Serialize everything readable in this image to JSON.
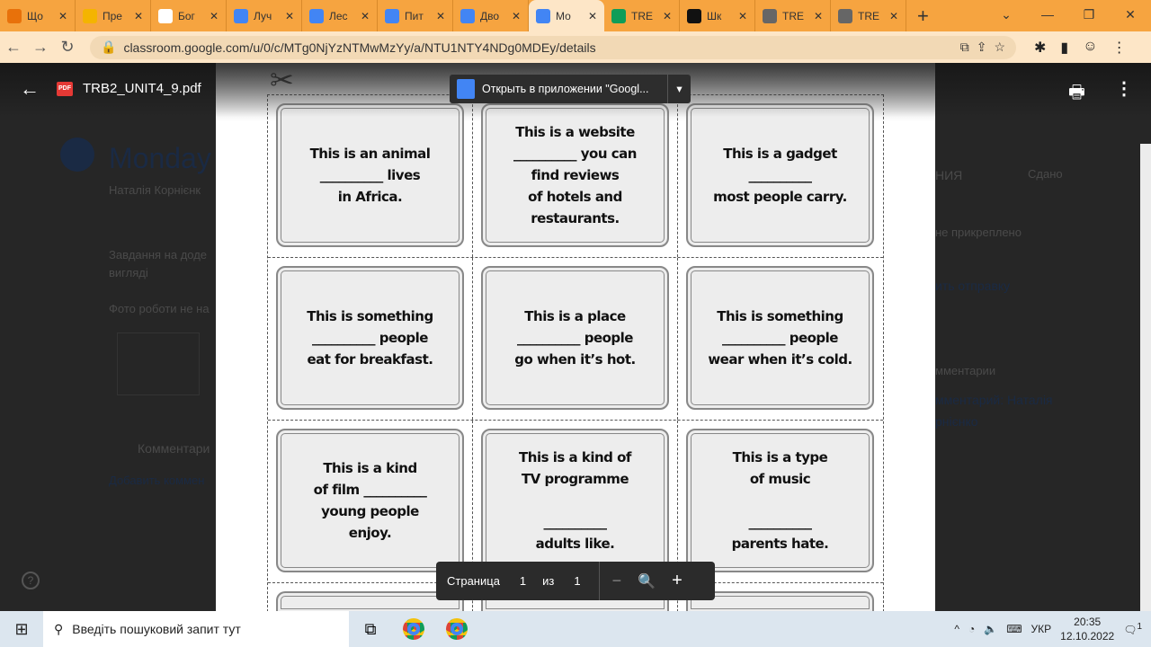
{
  "browser": {
    "tabs": [
      {
        "label": "Що",
        "icon": "slides-icon",
        "color": "#e8710a"
      },
      {
        "label": "Пре",
        "icon": "slides-icon",
        "color": "#f4b400"
      },
      {
        "label": "Бог",
        "icon": "wikipedia-icon",
        "color": "#ffffff"
      },
      {
        "label": "Луч",
        "icon": "google-icon",
        "color": "#4285f4"
      },
      {
        "label": "Лес",
        "icon": "google-icon",
        "color": "#4285f4"
      },
      {
        "label": "Пит",
        "icon": "google-icon",
        "color": "#4285f4"
      },
      {
        "label": "Дво",
        "icon": "google-icon",
        "color": "#4285f4"
      },
      {
        "label": "Мо",
        "icon": "classroom-icon",
        "color": "#4285f4",
        "active": true
      },
      {
        "label": "TRE",
        "icon": "drive-icon",
        "color": "#0f9d58"
      },
      {
        "label": "Шк",
        "icon": "site-icon",
        "color": "#111111"
      },
      {
        "label": "TRE",
        "icon": "globe-icon",
        "color": "#666666"
      },
      {
        "label": "TRE",
        "icon": "globe-icon",
        "color": "#666666"
      }
    ],
    "url": "classroom.google.com/u/0/c/MTg0NjYzNTMwMzYy/a/NTU1NTY4NDg0MDEy/details"
  },
  "background": {
    "title": "Monday",
    "author": "Наталія Корнієнк",
    "desc1": "Завдання на доде",
    "desc2": "вигляді",
    "desc3": "Фото роботи не на",
    "comments": "Комментари",
    "add_comment": "Добавить коммен",
    "right_heading": "НИЯ",
    "status": "Сдано",
    "not_attached": "не прикреплено",
    "cancel_submit": "ить отправку",
    "right_comments": "мментарии",
    "right_comment_author1": "мментарий: Наталія",
    "right_comment_author2": "рнієнко"
  },
  "viewer": {
    "filename": "TRB2_UNIT4_9.pdf",
    "open_in_app": "Открыть в приложении \"Googl...",
    "pager": {
      "label": "Страница",
      "current": "1",
      "of": "из",
      "total": "1"
    }
  },
  "cards": [
    [
      "This is an animal\n__________ lives\nin Africa.",
      "This is a website\n__________ you can\nfind reviews\nof hotels and\nrestaurants.",
      "This is a gadget\n__________\nmost people carry."
    ],
    [
      "This is something\n__________ people\neat for breakfast.",
      "This is a place\n__________ people\ngo when it’s hot.",
      "This is something\n__________ people\nwear when it’s cold."
    ],
    [
      "This is a kind\nof film __________\nyoung people\nenjoy.",
      "This is a kind of\nTV programme\n\n__________\nadults like.",
      "This is a type\nof music\n\n__________\nparents hate."
    ]
  ],
  "taskbar": {
    "search_placeholder": "Введіть пошуковий запит тут",
    "lang": "УКР",
    "time": "20:35",
    "date": "12.10.2022",
    "notifications": "1"
  }
}
